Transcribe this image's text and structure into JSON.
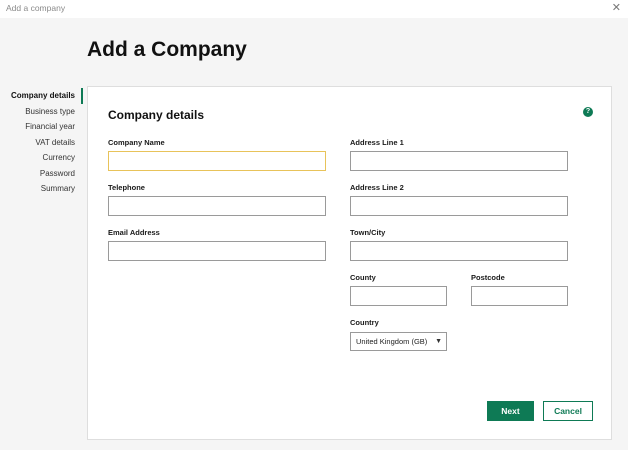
{
  "window": {
    "title": "Add a company",
    "close_glyph": "✕"
  },
  "page": {
    "heading": "Add a Company"
  },
  "nav": {
    "items": [
      {
        "label": "Company details"
      },
      {
        "label": "Business type"
      },
      {
        "label": "Financial year"
      },
      {
        "label": "VAT details"
      },
      {
        "label": "Currency"
      },
      {
        "label": "Password"
      },
      {
        "label": "Summary"
      }
    ]
  },
  "form": {
    "section_title": "Company details",
    "help_glyph": "?",
    "company_name": {
      "label": "Company Name",
      "value": ""
    },
    "telephone": {
      "label": "Telephone",
      "value": ""
    },
    "email": {
      "label": "Email Address",
      "value": ""
    },
    "address1": {
      "label": "Address Line 1",
      "value": ""
    },
    "address2": {
      "label": "Address Line 2",
      "value": ""
    },
    "town": {
      "label": "Town/City",
      "value": ""
    },
    "county": {
      "label": "County",
      "value": ""
    },
    "postcode": {
      "label": "Postcode",
      "value": ""
    },
    "country": {
      "label": "Country",
      "selected": "United Kingdom (GB)"
    }
  },
  "buttons": {
    "next": "Next",
    "cancel": "Cancel"
  },
  "colors": {
    "accent": "#0e7a55",
    "focus_border": "#e8c35a"
  },
  "icons": {
    "help": "help-icon",
    "close": "close-icon",
    "dropdown": "caret-down-icon"
  }
}
